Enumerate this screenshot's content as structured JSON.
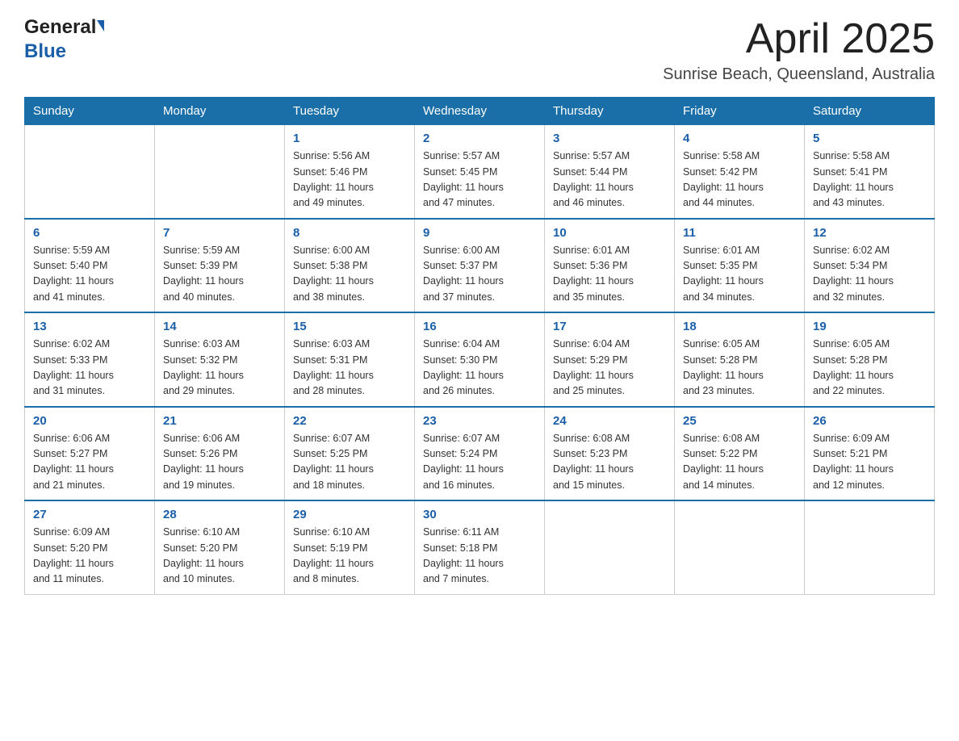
{
  "header": {
    "logo": {
      "general": "General",
      "blue": "Blue"
    },
    "month_title": "April 2025",
    "location": "Sunrise Beach, Queensland, Australia"
  },
  "calendar": {
    "days_of_week": [
      "Sunday",
      "Monday",
      "Tuesday",
      "Wednesday",
      "Thursday",
      "Friday",
      "Saturday"
    ],
    "weeks": [
      [
        {
          "day": "",
          "info": ""
        },
        {
          "day": "",
          "info": ""
        },
        {
          "day": "1",
          "info": "Sunrise: 5:56 AM\nSunset: 5:46 PM\nDaylight: 11 hours\nand 49 minutes."
        },
        {
          "day": "2",
          "info": "Sunrise: 5:57 AM\nSunset: 5:45 PM\nDaylight: 11 hours\nand 47 minutes."
        },
        {
          "day": "3",
          "info": "Sunrise: 5:57 AM\nSunset: 5:44 PM\nDaylight: 11 hours\nand 46 minutes."
        },
        {
          "day": "4",
          "info": "Sunrise: 5:58 AM\nSunset: 5:42 PM\nDaylight: 11 hours\nand 44 minutes."
        },
        {
          "day": "5",
          "info": "Sunrise: 5:58 AM\nSunset: 5:41 PM\nDaylight: 11 hours\nand 43 minutes."
        }
      ],
      [
        {
          "day": "6",
          "info": "Sunrise: 5:59 AM\nSunset: 5:40 PM\nDaylight: 11 hours\nand 41 minutes."
        },
        {
          "day": "7",
          "info": "Sunrise: 5:59 AM\nSunset: 5:39 PM\nDaylight: 11 hours\nand 40 minutes."
        },
        {
          "day": "8",
          "info": "Sunrise: 6:00 AM\nSunset: 5:38 PM\nDaylight: 11 hours\nand 38 minutes."
        },
        {
          "day": "9",
          "info": "Sunrise: 6:00 AM\nSunset: 5:37 PM\nDaylight: 11 hours\nand 37 minutes."
        },
        {
          "day": "10",
          "info": "Sunrise: 6:01 AM\nSunset: 5:36 PM\nDaylight: 11 hours\nand 35 minutes."
        },
        {
          "day": "11",
          "info": "Sunrise: 6:01 AM\nSunset: 5:35 PM\nDaylight: 11 hours\nand 34 minutes."
        },
        {
          "day": "12",
          "info": "Sunrise: 6:02 AM\nSunset: 5:34 PM\nDaylight: 11 hours\nand 32 minutes."
        }
      ],
      [
        {
          "day": "13",
          "info": "Sunrise: 6:02 AM\nSunset: 5:33 PM\nDaylight: 11 hours\nand 31 minutes."
        },
        {
          "day": "14",
          "info": "Sunrise: 6:03 AM\nSunset: 5:32 PM\nDaylight: 11 hours\nand 29 minutes."
        },
        {
          "day": "15",
          "info": "Sunrise: 6:03 AM\nSunset: 5:31 PM\nDaylight: 11 hours\nand 28 minutes."
        },
        {
          "day": "16",
          "info": "Sunrise: 6:04 AM\nSunset: 5:30 PM\nDaylight: 11 hours\nand 26 minutes."
        },
        {
          "day": "17",
          "info": "Sunrise: 6:04 AM\nSunset: 5:29 PM\nDaylight: 11 hours\nand 25 minutes."
        },
        {
          "day": "18",
          "info": "Sunrise: 6:05 AM\nSunset: 5:28 PM\nDaylight: 11 hours\nand 23 minutes."
        },
        {
          "day": "19",
          "info": "Sunrise: 6:05 AM\nSunset: 5:28 PM\nDaylight: 11 hours\nand 22 minutes."
        }
      ],
      [
        {
          "day": "20",
          "info": "Sunrise: 6:06 AM\nSunset: 5:27 PM\nDaylight: 11 hours\nand 21 minutes."
        },
        {
          "day": "21",
          "info": "Sunrise: 6:06 AM\nSunset: 5:26 PM\nDaylight: 11 hours\nand 19 minutes."
        },
        {
          "day": "22",
          "info": "Sunrise: 6:07 AM\nSunset: 5:25 PM\nDaylight: 11 hours\nand 18 minutes."
        },
        {
          "day": "23",
          "info": "Sunrise: 6:07 AM\nSunset: 5:24 PM\nDaylight: 11 hours\nand 16 minutes."
        },
        {
          "day": "24",
          "info": "Sunrise: 6:08 AM\nSunset: 5:23 PM\nDaylight: 11 hours\nand 15 minutes."
        },
        {
          "day": "25",
          "info": "Sunrise: 6:08 AM\nSunset: 5:22 PM\nDaylight: 11 hours\nand 14 minutes."
        },
        {
          "day": "26",
          "info": "Sunrise: 6:09 AM\nSunset: 5:21 PM\nDaylight: 11 hours\nand 12 minutes."
        }
      ],
      [
        {
          "day": "27",
          "info": "Sunrise: 6:09 AM\nSunset: 5:20 PM\nDaylight: 11 hours\nand 11 minutes."
        },
        {
          "day": "28",
          "info": "Sunrise: 6:10 AM\nSunset: 5:20 PM\nDaylight: 11 hours\nand 10 minutes."
        },
        {
          "day": "29",
          "info": "Sunrise: 6:10 AM\nSunset: 5:19 PM\nDaylight: 11 hours\nand 8 minutes."
        },
        {
          "day": "30",
          "info": "Sunrise: 6:11 AM\nSunset: 5:18 PM\nDaylight: 11 hours\nand 7 minutes."
        },
        {
          "day": "",
          "info": ""
        },
        {
          "day": "",
          "info": ""
        },
        {
          "day": "",
          "info": ""
        }
      ]
    ]
  }
}
